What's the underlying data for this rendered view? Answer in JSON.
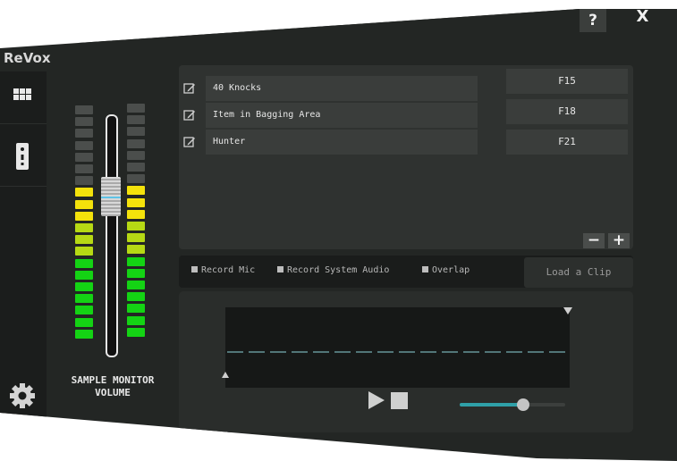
{
  "window": {
    "title": "ReVox",
    "help_label": "?",
    "close_label": "X"
  },
  "sidebar": {
    "items": [
      {
        "icon": "grid-icon"
      },
      {
        "icon": "power-outlet-icon"
      }
    ],
    "settings_icon": "gear-icon"
  },
  "monitor": {
    "label_line1": "SAMPLE MONITOR",
    "label_line2": "VOLUME",
    "meter": {
      "segments_per_column": 20,
      "off_segments": 7,
      "yellow_segments": 3,
      "yellow_green_segments": 3,
      "green_segments": 7
    },
    "fader_level": 0.72,
    "colors": {
      "segment_off": "#4b4e4c",
      "segment_yellow": "#f4e20b",
      "segment_yellow_green": "#b6d914",
      "segment_green": "#14d314"
    }
  },
  "clips": [
    {
      "name": "40 Knocks",
      "hotkey": "F15"
    },
    {
      "name": "Item in Bagging Area",
      "hotkey": "F18"
    },
    {
      "name": "Hunter",
      "hotkey": "F21"
    }
  ],
  "clip_controls": {
    "remove_label": "−",
    "add_label": "+"
  },
  "options": {
    "record_mic": {
      "label": "Record Mic",
      "checked": false
    },
    "record_system_audio": {
      "label": "Record System Audio",
      "checked": false
    },
    "overlap": {
      "label": "Overlap",
      "checked": false
    },
    "load_clip_label": "Load a Clip"
  },
  "player": {
    "play_icon": "play-icon",
    "stop_icon": "stop-icon",
    "volume": 0.6,
    "accent_color": "#2fa0a8"
  }
}
